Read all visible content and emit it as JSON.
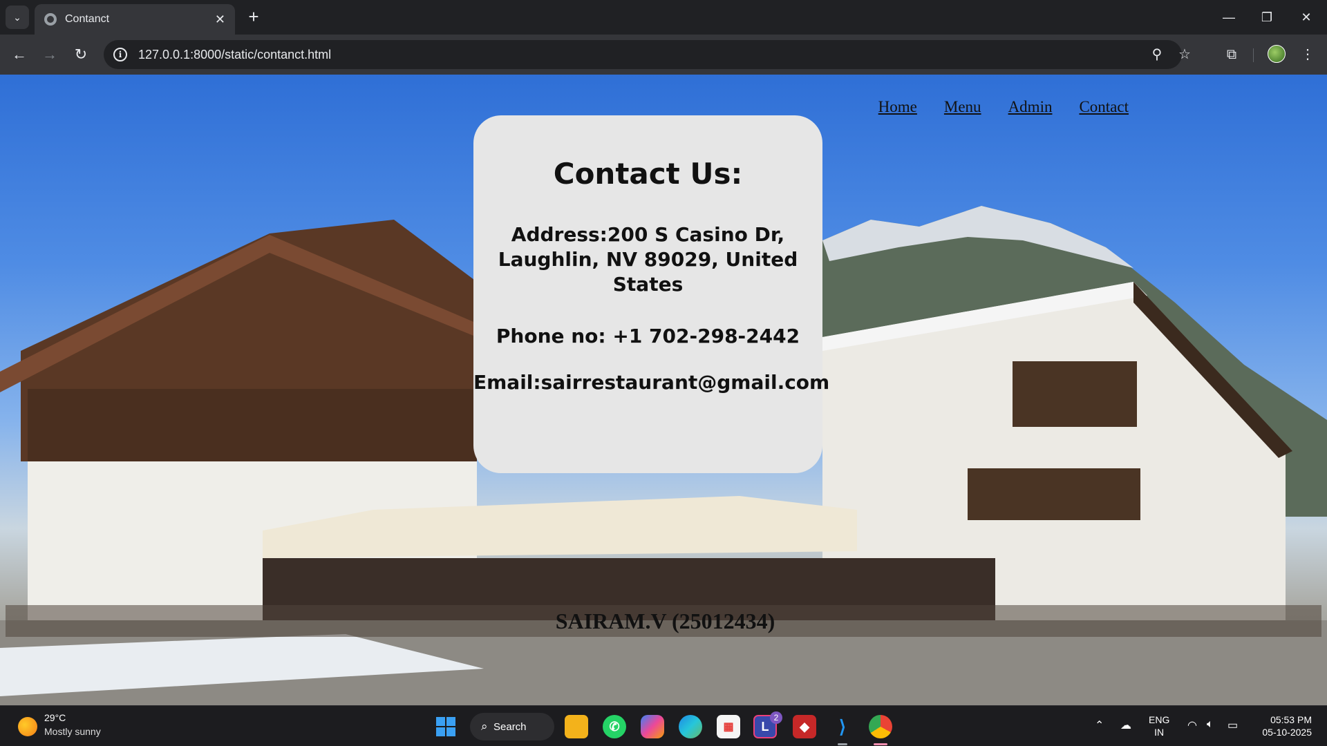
{
  "browser": {
    "tab_title": "Contanct",
    "url": "127.0.0.1:8000/static/contanct.html"
  },
  "site": {
    "nav": [
      "Home",
      "Menu",
      "Admin",
      "Contact"
    ],
    "card": {
      "heading": "Contact Us:",
      "address": "Address:200 S Casino Dr, Laughlin, NV 89029, United States",
      "phone": "Phone no: +1 702-298-2442",
      "email": "Email:sairrestaurant@gmail.com"
    },
    "footer": "SAIRAM.V (25012434)"
  },
  "taskbar": {
    "weather_temp": "29°C",
    "weather_desc": "Mostly sunny",
    "search_label": "Search",
    "lang_primary": "ENG",
    "lang_secondary": "IN",
    "time": "05:53 PM",
    "date": "05-10-2025",
    "badge_count": "2"
  },
  "colors": {
    "card_bg": "#e6e6e6",
    "chrome_dark": "#202124",
    "chrome_toolbar": "#35363a"
  }
}
